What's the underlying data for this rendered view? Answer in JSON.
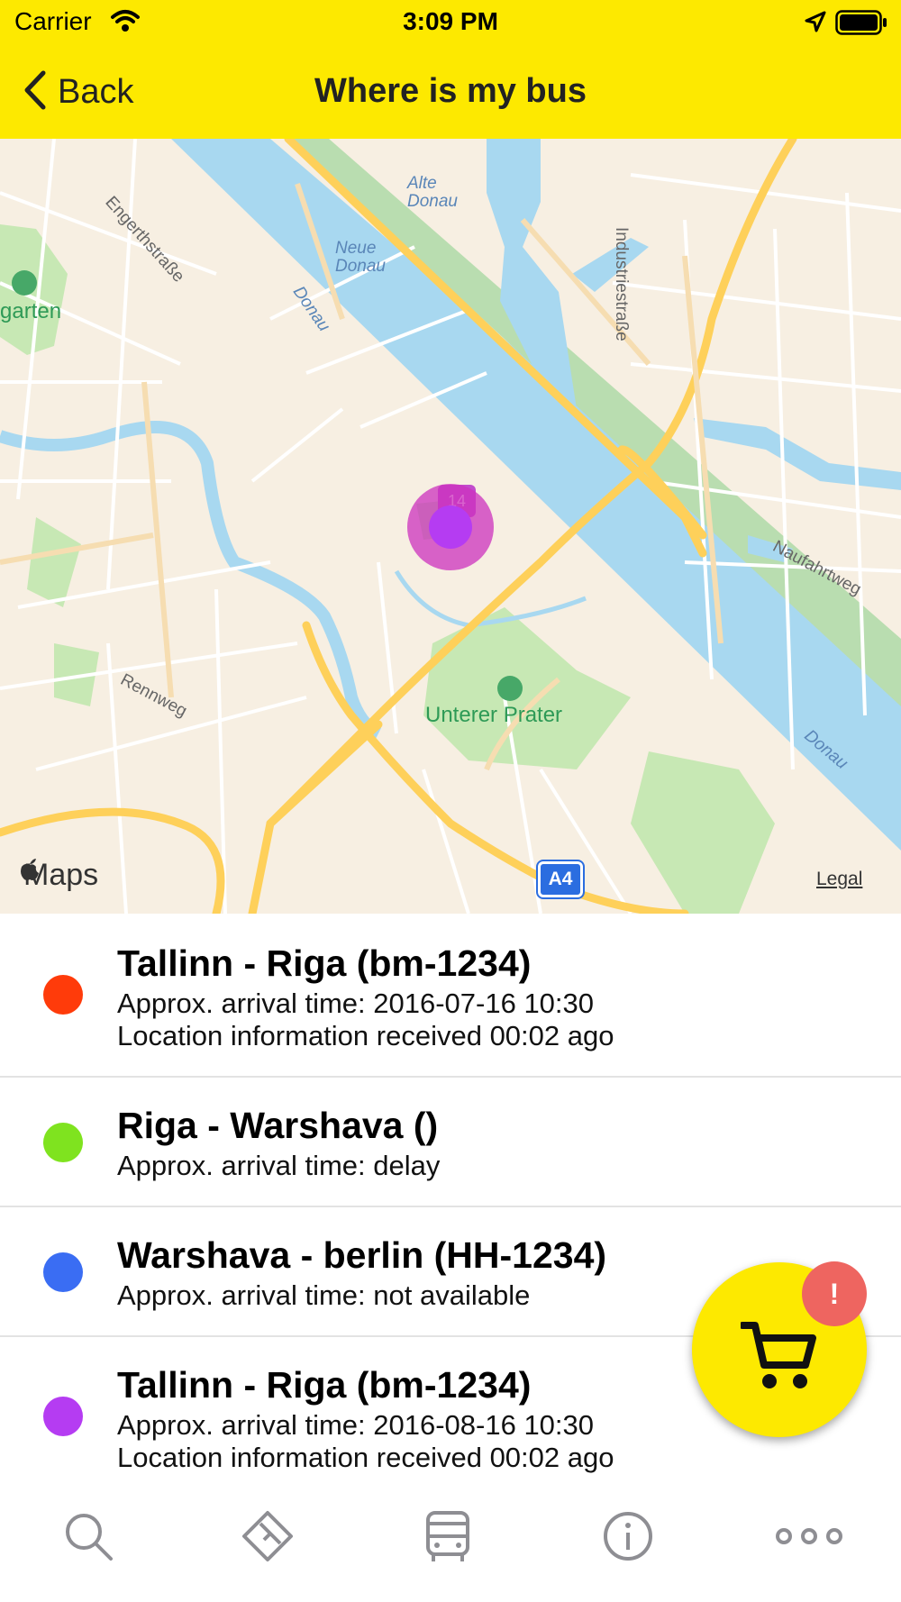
{
  "status_bar": {
    "carrier": "Carrier",
    "time": "3:09 PM"
  },
  "header": {
    "back_label": "Back",
    "title": "Where is my bus"
  },
  "map": {
    "labels": {
      "engerthstrasse": "Engerthstraße",
      "alte_donau": "Alte\nDonau",
      "neue_donau": "Neue\nDonau",
      "donau_1": "Donau",
      "industriestrasse": "Industriestraße",
      "garten": "garten",
      "naufahrtweg": "Naufahrtweg",
      "rennweg": "Rennweg",
      "unterer_prater": "Unterer Prater",
      "donau_2": "Donau"
    },
    "route_badge": "14",
    "highway_badge": "A4",
    "maps_logo": "Maps",
    "legal": "Legal",
    "bus_marker_color": "#b53cf2"
  },
  "buses": [
    {
      "title": "Tallinn - Riga (bm-1234)",
      "arrival": "Approx. arrival time: 2016-07-16 10:30",
      "location": "Location information received 00:02 ago",
      "color": "#ff3b0a"
    },
    {
      "title": "Riga - Warshava ()",
      "arrival": "Approx. arrival time: delay",
      "color": "#7fe31f"
    },
    {
      "title": "Warshava - berlin (HH-1234)",
      "arrival": "Approx. arrival time: not available",
      "color": "#3a6df3"
    },
    {
      "title": "Tallinn - Riga (bm-1234)",
      "arrival": "Approx. arrival time: 2016-08-16 10:30",
      "location": "Location information received 00:02 ago",
      "color": "#b53cf2"
    }
  ],
  "cart": {
    "badge": "!"
  },
  "tabs": [
    "search-icon",
    "ticket-icon",
    "bus-icon",
    "info-icon",
    "more-icon"
  ],
  "colors": {
    "brand_yellow": "#fde900",
    "alert_red": "#ee6560",
    "tab_gray": "#8e8e93"
  }
}
